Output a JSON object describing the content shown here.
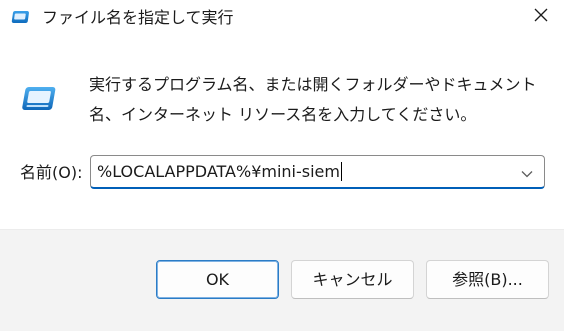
{
  "window": {
    "title": "ファイル名を指定して実行",
    "close_glyph": "✕"
  },
  "description": {
    "text": "実行するプログラム名、または開くフォルダーやドキュメント名、インターネット リソース名を入力してください。"
  },
  "open_field": {
    "label": "名前(O):",
    "value": "%LOCALAPPDATA%¥mini-siem"
  },
  "buttons": {
    "ok_label": "OK",
    "cancel_label": "キャンセル",
    "browse_label": "参照(B)..."
  },
  "colors": {
    "accent": "#005fb8",
    "footer_bg": "#f3f3f3",
    "icon_blue": "#1e88d8"
  },
  "icons": {
    "title": "run-app-icon",
    "main": "run-app-icon",
    "close": "close-icon",
    "dropdown": "chevron-down-icon"
  }
}
